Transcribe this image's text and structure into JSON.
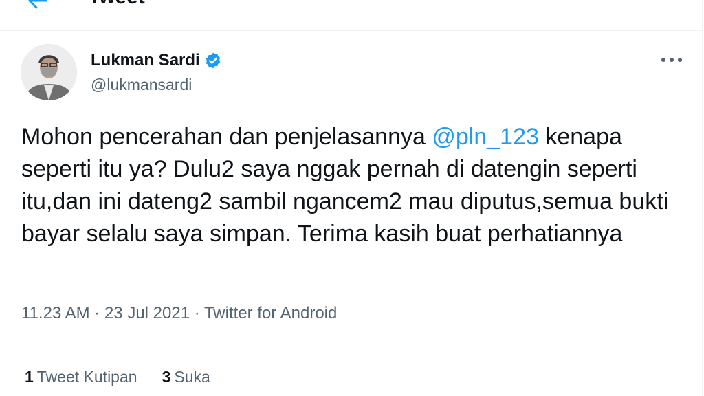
{
  "header": {
    "title": "Tweet"
  },
  "tweet": {
    "author_name": "Lukman Sardi",
    "handle": "@lukmansardi",
    "text_before": "Mohon pencerahan dan penjelasannya ",
    "mention": "@pln_123",
    "text_after": " kenapa seperti itu ya? Dulu2 saya nggak pernah di datengin seperti itu,dan ini dateng2 sambil ngancem2 mau diputus,semua bukti bayar selalu saya simpan. Terima kasih buat perhatiannya",
    "meta": "11.23 AM · 23 Jul 2021 · Twitter for Android"
  },
  "stats": {
    "quote_count": "1",
    "quote_label": "Tweet Kutipan",
    "like_count": "3",
    "like_label": "Suka"
  },
  "colors": {
    "accent": "#1d9bf0",
    "text": "#0f1419",
    "secondary": "#536471",
    "divider": "#eff3f4"
  },
  "icons": [
    "back-arrow-icon",
    "verified-badge-icon",
    "more-options-icon"
  ]
}
